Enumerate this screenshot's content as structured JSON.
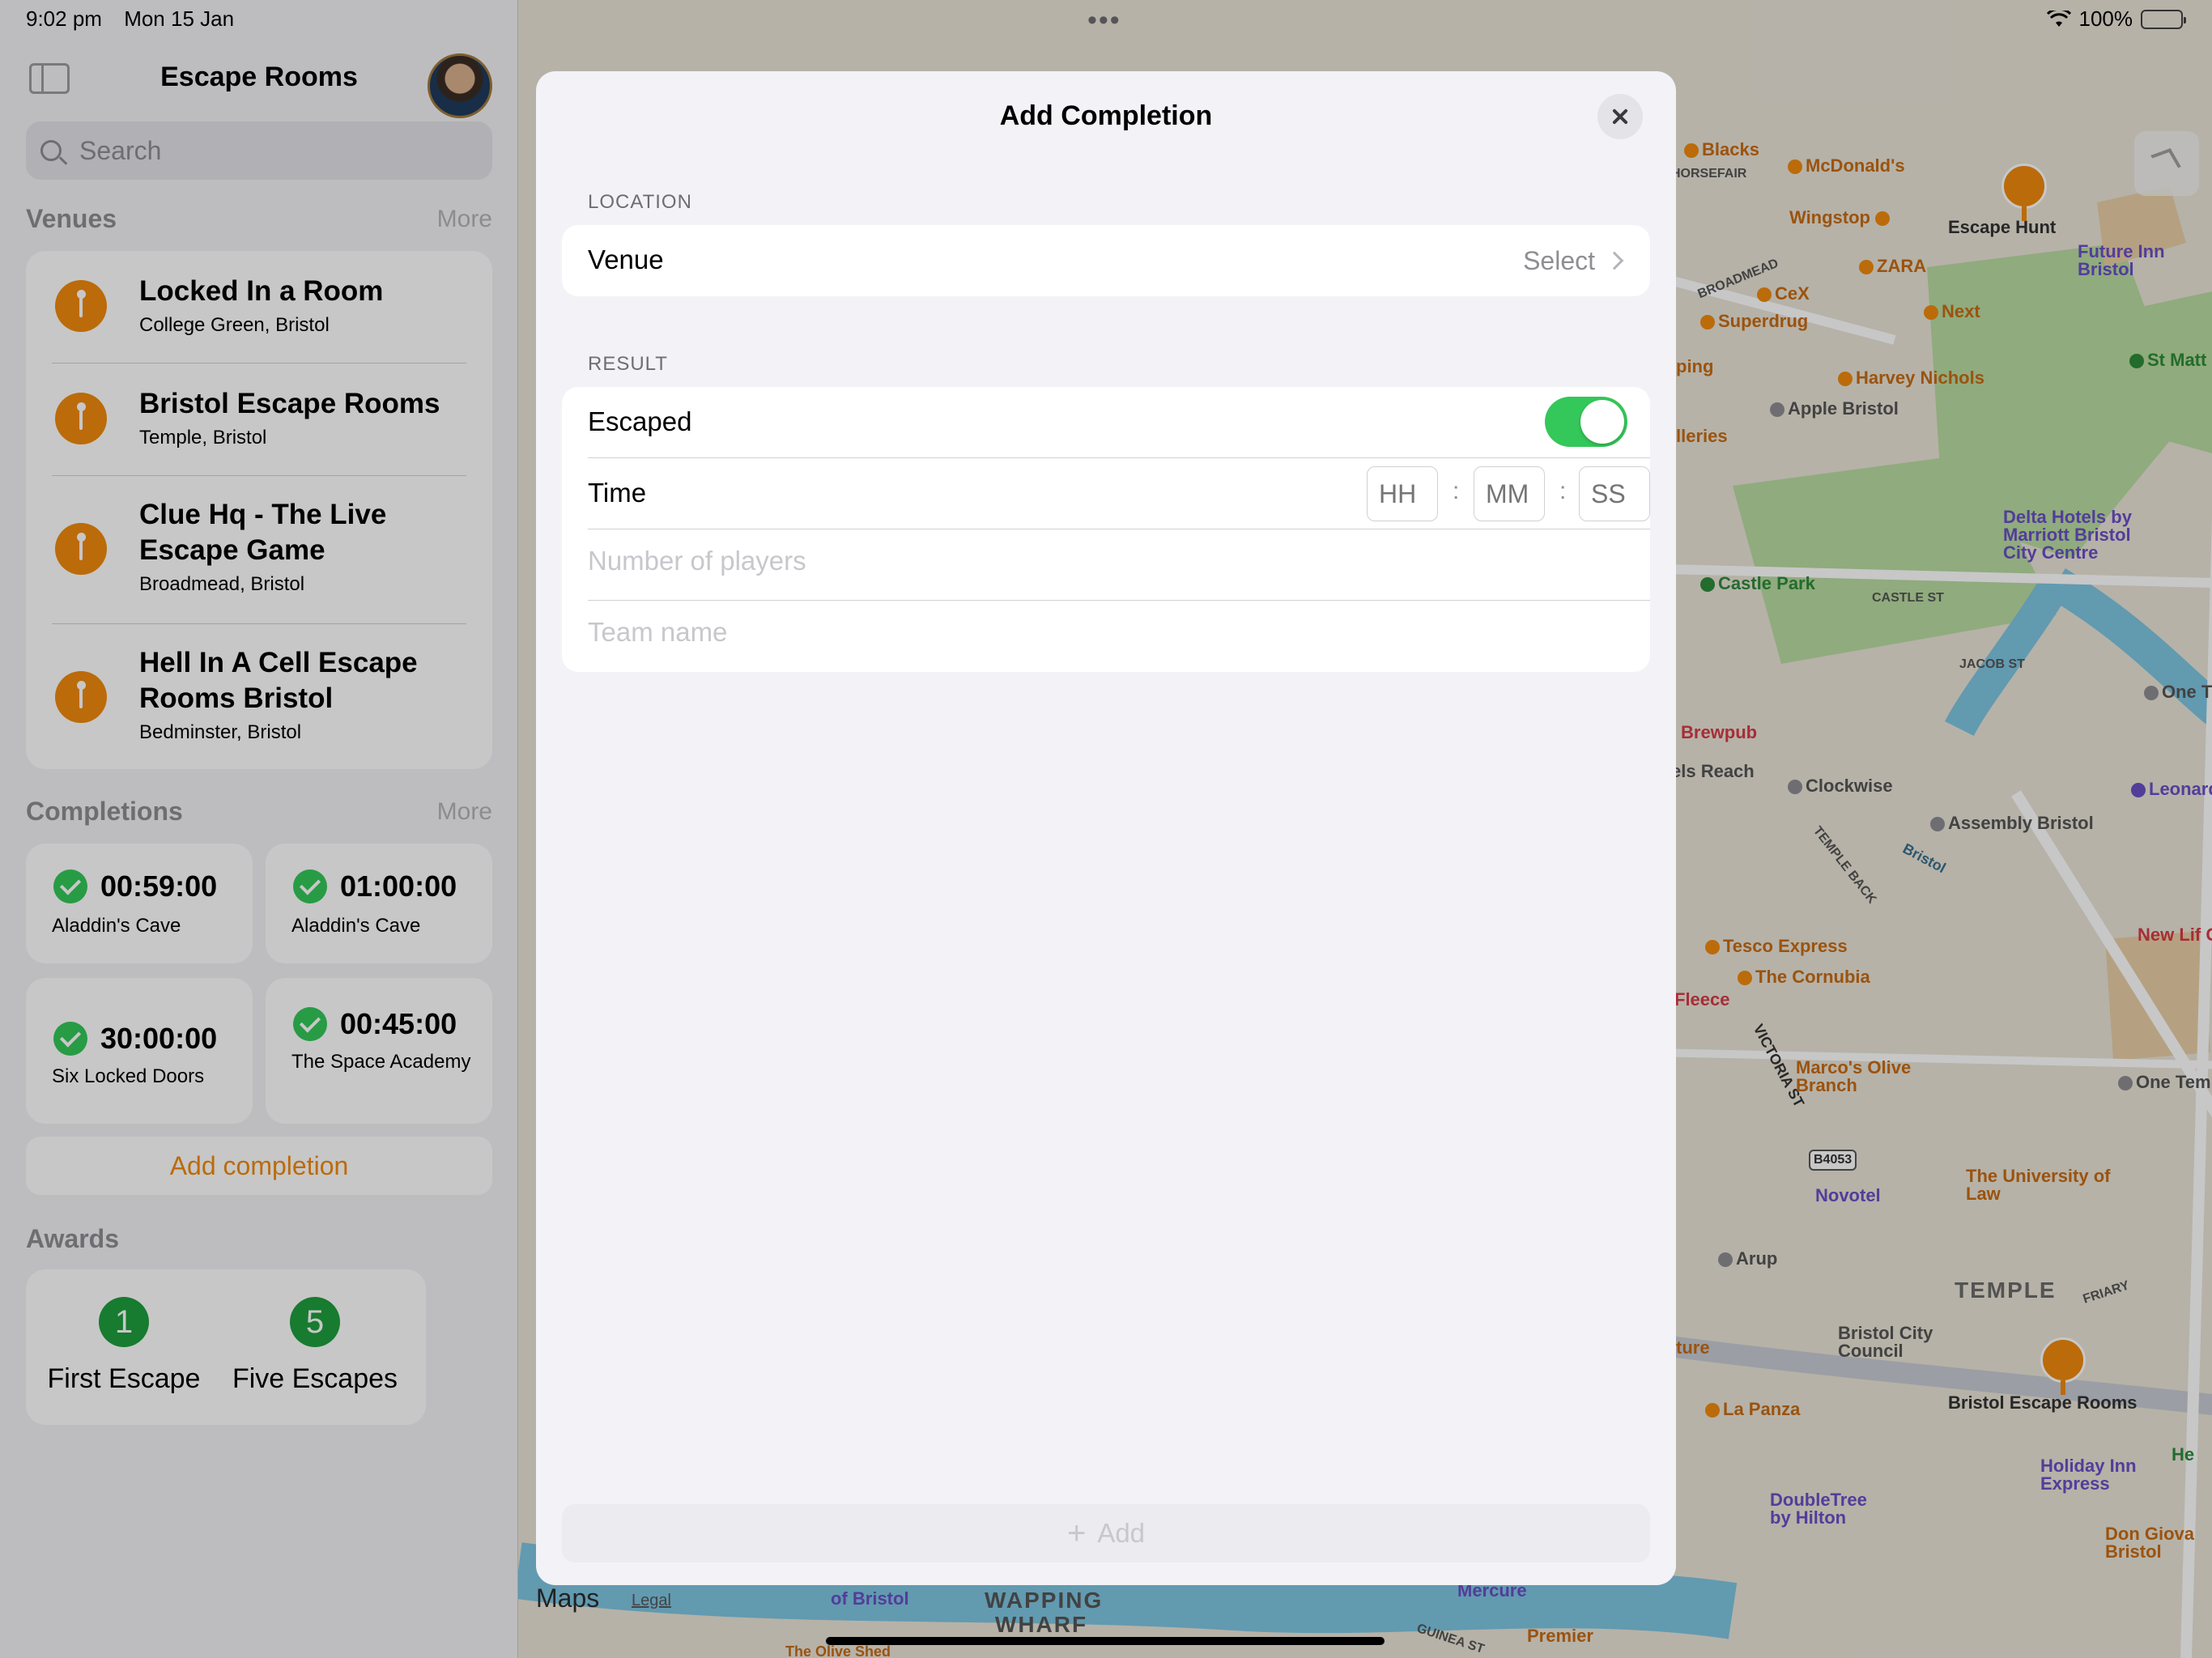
{
  "status_bar": {
    "time": "9:02 pm",
    "date": "Mon 15 Jan",
    "multitask_dots": "•••",
    "battery_percent": "100%"
  },
  "sidebar": {
    "title": "Escape Rooms",
    "search_placeholder": "Search",
    "venues_heading": "Venues",
    "venues_more": "More",
    "venues": [
      {
        "name": "Locked In a Room",
        "area": "College Green, Bristol"
      },
      {
        "name": "Bristol Escape Rooms",
        "area": "Temple, Bristol"
      },
      {
        "name": "Clue Hq - The Live Escape Game",
        "area": "Broadmead, Bristol"
      },
      {
        "name": "Hell In A Cell Escape Rooms Bristol",
        "area": "Bedminster, Bristol"
      }
    ],
    "completions_heading": "Completions",
    "completions_more": "More",
    "completions": [
      {
        "time": "00:59:00",
        "room": "Aladdin's Cave"
      },
      {
        "time": "01:00:00",
        "room": "Aladdin's Cave"
      },
      {
        "time": "30:00:00",
        "room": "Six Locked Doors"
      },
      {
        "time": "00:45:00",
        "room": "The Space Academy"
      }
    ],
    "add_completion_label": "Add completion",
    "awards_heading": "Awards",
    "awards": [
      {
        "count": "1",
        "label": "First Escape"
      },
      {
        "count": "5",
        "label": "Five Escapes"
      }
    ]
  },
  "modal": {
    "title": "Add Completion",
    "location_header": "LOCATION",
    "venue_label": "Venue",
    "venue_value": "Select",
    "result_header": "RESULT",
    "escaped_label": "Escaped",
    "escaped_on": true,
    "time_label": "Time",
    "hh_placeholder": "HH",
    "mm_placeholder": "MM",
    "ss_placeholder": "SS",
    "time_separator": ":",
    "players_placeholder": "Number of players",
    "team_placeholder": "Team name",
    "add_label": "Add"
  },
  "map": {
    "labels": {
      "blacks": "Blacks",
      "horsefair": "HORSEFAIR",
      "mcdonalds": "McDonald's",
      "wingstop": "Wingstop",
      "escape_hunt": "Escape Hunt",
      "future_inn": "Future Inn Bristol",
      "zara": "ZARA",
      "broadmead": "BROADMEAD",
      "cex": "CeX",
      "superdrug": "Superdrug",
      "next": "Next",
      "st_matt": "St Matt",
      "harvey_nichols": "Harvey Nichols",
      "apple_bristol": "Apple Bristol",
      "ping": "ping",
      "lleries": "lleries",
      "delta_hotels": "Delta Hotels by Marriott Bristol City Centre",
      "castle_park": "Castle Park",
      "castle_st": "CASTLE ST",
      "jacob_st": "JACOB ST",
      "one_t": "One T",
      "brewpub": "Brewpub",
      "els_reach": "els Reach",
      "clockwise": "Clockwise",
      "leonardo": "Leonardo h",
      "assembly_bristol": "Assembly Bristol",
      "bristol_river": "Bristol",
      "temple_back": "TEMPLE BACK",
      "new_life": "New Lif Classes",
      "tesco": "Tesco Express",
      "cornubia": "The Cornubia",
      "fleece": "Fleece",
      "victoria_st": "VICTORIA ST",
      "marcos": "Marco's Olive Branch",
      "one_temple": "One Tem",
      "b4053": "B4053",
      "novotel": "Novotel",
      "university_law": "The University of Law",
      "arup": "Arup",
      "temple": "TEMPLE",
      "friary": "FRIARY",
      "bristol_city_council": "Bristol City Council",
      "ture": "ture",
      "la_panza": "La Panza",
      "bristol_escape_rooms": "Bristol Escape Rooms",
      "holiday_inn": "Holiday Inn Express",
      "doubletree": "DoubleTree by Hilton",
      "don_giova": "Don Giova Bristol",
      "wapping_wharf": "WAPPING WHARF",
      "of_bristol": "of Bristol",
      "mercure": "Mercure",
      "premier": "Premier",
      "guinea_st": "GUINEA ST",
      "olive_shed": "The Olive Shed",
      "he": "He",
      "maps_brand": "Maps",
      "legal": "Legal"
    }
  }
}
